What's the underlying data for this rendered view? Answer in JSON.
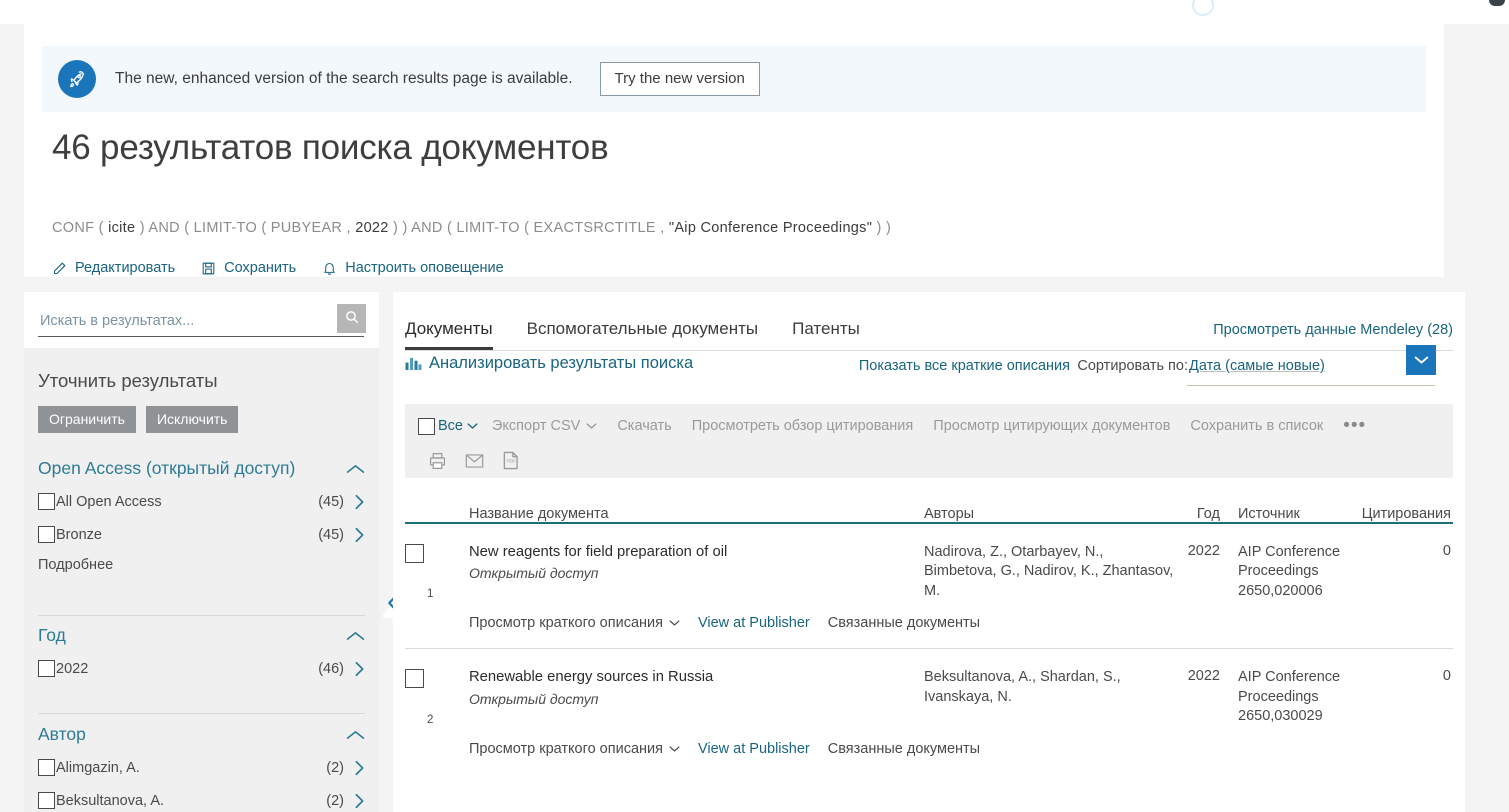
{
  "banner": {
    "icon": "rocket-icon",
    "message": "The new, enhanced version of the search results page is available.",
    "button_label": "Try the new version"
  },
  "header": {
    "title": "46 результатов поиска документов",
    "query_parts": [
      {
        "text": "CONF ( ",
        "strong": false
      },
      {
        "text": "icite",
        "strong": true
      },
      {
        "text": " ) AND ( LIMIT-TO ( PUBYEAR , ",
        "strong": false
      },
      {
        "text": "2022",
        "strong": true
      },
      {
        "text": " ) ) AND ( LIMIT-TO ( EXACTSRCTITLE , ",
        "strong": false
      },
      {
        "text": "\"Aip Conference Proceedings\"",
        "strong": true
      },
      {
        "text": " ) )",
        "strong": false
      }
    ],
    "query_full": "CONF ( icite ) AND ( LIMIT-TO ( PUBYEAR , 2022 ) ) AND ( LIMIT-TO ( EXACTSRCTITLE , \"Aip Conference Proceedings\" ) )",
    "actions": [
      {
        "icon": "pencil-icon",
        "label": "Редактировать"
      },
      {
        "icon": "save-disk-icon",
        "label": "Сохранить"
      },
      {
        "icon": "bell-icon",
        "label": "Настроить оповещение"
      }
    ]
  },
  "sidebar": {
    "search_placeholder": "Искать в результатах...",
    "search_value": "",
    "search_icon": "search-icon",
    "refine_title": "Уточнить результаты",
    "limit_label": "Ограничить",
    "exclude_label": "Исключить",
    "facets": [
      {
        "name": "Open Access (открытый доступ)",
        "expanded": true,
        "items": [
          {
            "label": "All Open Access",
            "count": "(45)",
            "checked": false
          },
          {
            "label": "Bronze",
            "count": "(45)",
            "checked": false
          }
        ],
        "more_label": "Подробнее"
      },
      {
        "name": "Год",
        "expanded": true,
        "items": [
          {
            "label": "2022",
            "count": "(46)",
            "checked": false
          }
        ],
        "more_label": ""
      },
      {
        "name": "Автор",
        "expanded": true,
        "items": [
          {
            "label": "Alimgazin, A.",
            "count": "(2)",
            "checked": false
          },
          {
            "label": "Beksultanova, A.",
            "count": "(2)",
            "checked": false
          }
        ],
        "more_label": ""
      }
    ],
    "collapse_icon": "double-chevron-left-icon"
  },
  "main": {
    "tabs": [
      {
        "label": "Документы",
        "active": true
      },
      {
        "label": "Вспомогательные документы",
        "active": false
      },
      {
        "label": "Патенты",
        "active": false
      }
    ],
    "mendeley_link": "Просмотреть данные Mendeley (28)",
    "analyze_label": "Анализировать результаты поиска",
    "analyze_icon": "bar-chart-icon",
    "show_abstracts_label": "Показать все краткие описания",
    "sort_label": "Сортировать по:",
    "sort_value": "Дата (самые новые)",
    "sort_dropdown_icon": "chevron-down-icon",
    "toolbar": {
      "select_all_label": "Все",
      "select_all_icon": "chevron-down-icon",
      "items": [
        {
          "label": "Экспорт CSV",
          "caret": true
        },
        {
          "label": "Скачать",
          "caret": false
        },
        {
          "label": "Просмотреть обзор цитирования",
          "caret": false
        },
        {
          "label": "Просмотр цитирующих документов",
          "caret": false
        },
        {
          "label": "Сохранить в список",
          "caret": false
        }
      ],
      "more_label": "•••",
      "icons": [
        "print-icon",
        "email-icon",
        "pdf-icon"
      ]
    },
    "columns": {
      "title": "Название документа",
      "authors": "Авторы",
      "year": "Год",
      "source": "Источник",
      "citations": "Цитирования"
    },
    "results": [
      {
        "num": "1",
        "title": "New reagents for field preparation of oil",
        "open_access": "Открытый доступ",
        "authors": "Nadirova, Z., Otarbayev, N., Bimbetova, G., Nadirov, K., Zhantasov, M.",
        "year": "2022",
        "source": "AIP Conference Proceedings\n2650,020006",
        "source_name": "AIP Conference Proceedings",
        "source_ref": "2650,020006",
        "citations": "0",
        "actions": [
          {
            "label": "Просмотр краткого описания",
            "caret": true,
            "link": false
          },
          {
            "label": "View at Publisher",
            "caret": false,
            "link": true
          },
          {
            "label": "Связанные документы",
            "caret": false,
            "link": false
          }
        ]
      },
      {
        "num": "2",
        "title": "Renewable energy sources in Russia",
        "open_access": "Открытый доступ",
        "authors": "Beksultanova, A., Shardan, S., Ivanskaya, N.",
        "year": "2022",
        "source_name": "AIP Conference Proceedings",
        "source_ref": "2650,030029",
        "citations": "0",
        "actions": [
          {
            "label": "Просмотр краткого описания",
            "caret": true,
            "link": false
          },
          {
            "label": "View at Publisher",
            "caret": false,
            "link": true
          },
          {
            "label": "Связанные документы",
            "caret": false,
            "link": false
          }
        ]
      }
    ]
  },
  "colors": {
    "accent_blue": "#1b75bb",
    "link_teal": "#19647e",
    "facet_teal": "#2e7b96",
    "table_rule": "#1b6e7e",
    "banner_bg": "#f2f8fb",
    "panel_grey": "#f0f0f0",
    "page_bg": "#f4f4f4"
  }
}
